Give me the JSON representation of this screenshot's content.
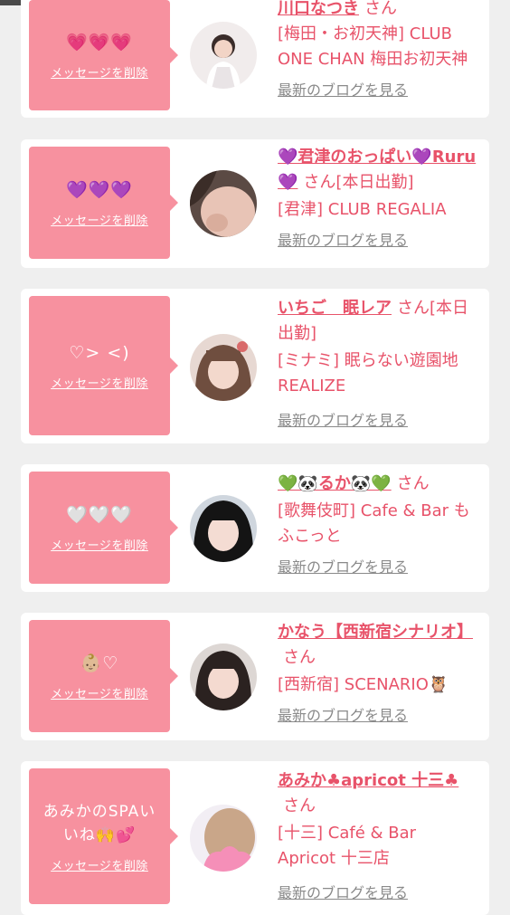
{
  "cards": [
    {
      "message": "💗💗💗",
      "delete_label": "メッセージを削除",
      "name": "川口なつき",
      "san": "さん",
      "shop": "[梅田・お初天神] CLUB ONE CHAN 梅田お初天神",
      "blog_label": "最新のブログを見る"
    },
    {
      "message": "💜💜💜",
      "delete_label": "メッセージを削除",
      "name": "💜君津のおっぱい💜Ruru💜",
      "san": "さん[本日出勤]",
      "shop": "[君津] CLUB REGALIA",
      "blog_label": "最新のブログを見る"
    },
    {
      "message": "♡> <)",
      "delete_label": "メッセージを削除",
      "name": "いちご　眠レア",
      "san": "さん[本日出勤]",
      "shop": "[ミナミ] 眠らない遊園地REALIZE",
      "blog_label": "最新のブログを見る"
    },
    {
      "message": "🤍🤍🤍",
      "delete_label": "メッセージを削除",
      "name": "💚🐼るか🐼💚",
      "san": "さん",
      "shop": "[歌舞伎町] Cafe & Bar もふこっと",
      "blog_label": "最新のブログを見る"
    },
    {
      "message": "👶🏼♡",
      "delete_label": "メッセージを削除",
      "name": "かなう【西新宿シナリオ】",
      "san": "さん",
      "shop": "[西新宿] SCENARIO🦉",
      "blog_label": "最新のブログを見る"
    },
    {
      "message": "あみかのSPAいいね🙌💕",
      "delete_label": "メッセージを削除",
      "name": "あみか♣apricot 十三♣",
      "san": "さん",
      "shop": "[十三] Café & Bar Apricot 十三店",
      "blog_label": "最新のブログを見る"
    }
  ],
  "colors": {
    "bubble": "#f7919f",
    "accent": "#e8536a",
    "muted": "#8a8a8a",
    "background": "#efefef"
  }
}
